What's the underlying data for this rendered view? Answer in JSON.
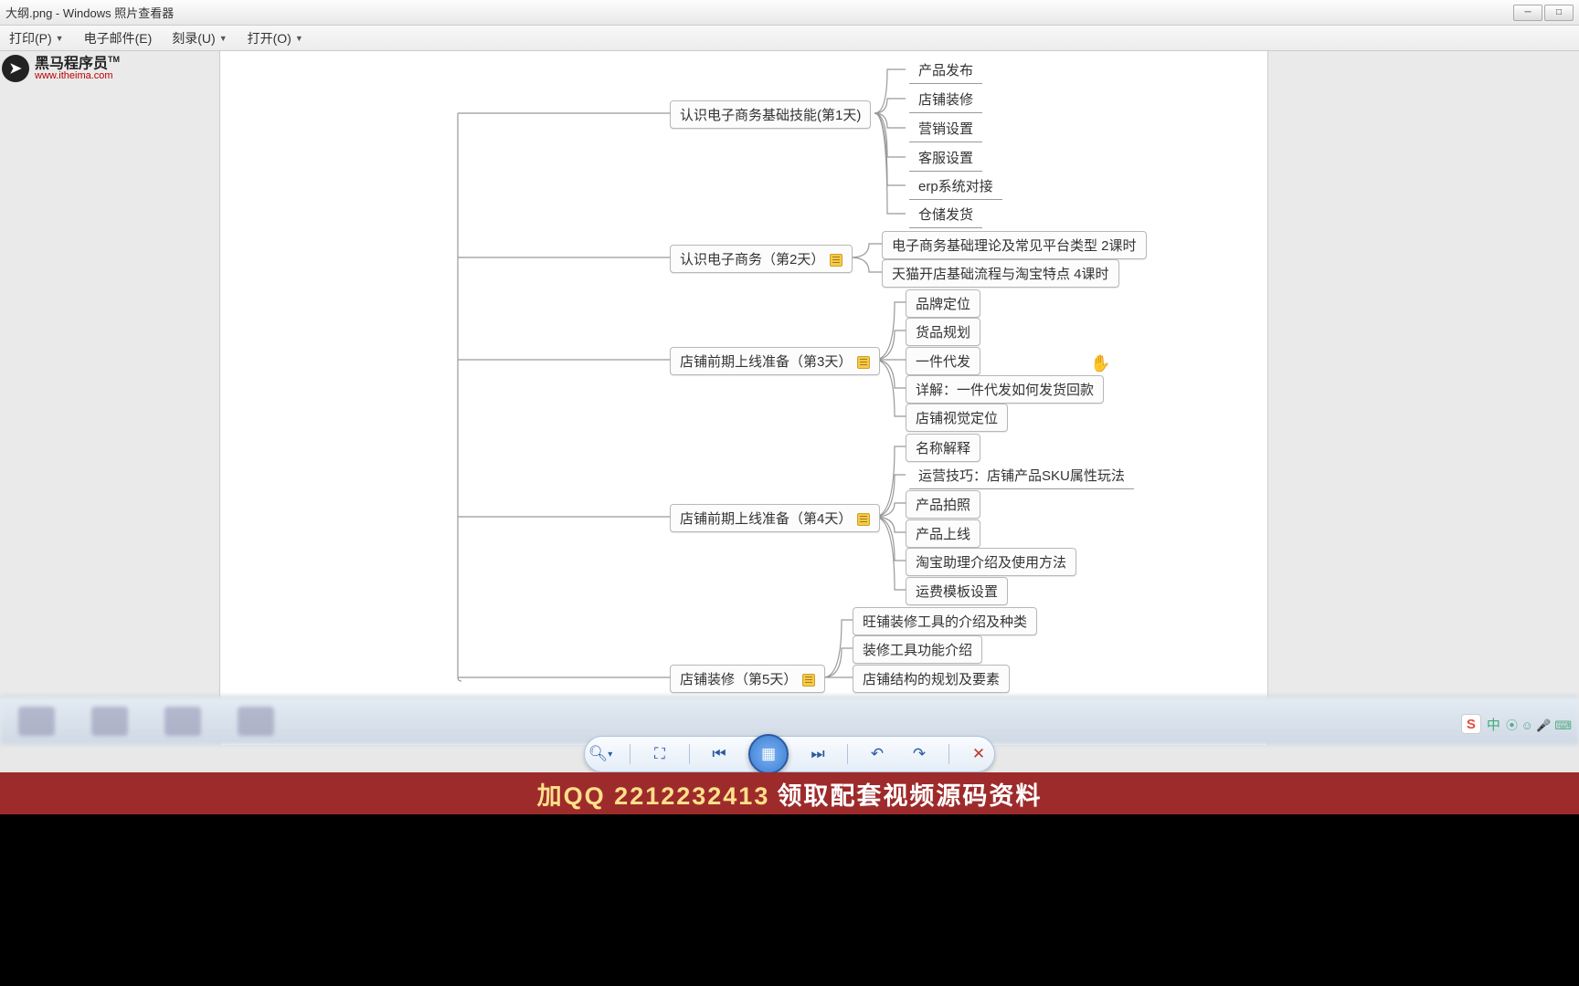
{
  "window": {
    "title_suffix": "大纲.png - Windows 照片查看器"
  },
  "menu": {
    "print": "打印(P)",
    "email": "电子邮件(E)",
    "burn": "刻录(U)",
    "open": "打开(O)"
  },
  "logo": {
    "cn": "黑马程序员",
    "en": "www.itheima.com",
    "tm": "TM"
  },
  "mindmap": {
    "n1": {
      "label": "认识电子商务基础技能(第1天)",
      "children": [
        "产品发布",
        "店铺装修",
        "营销设置",
        "客服设置",
        "erp系统对接",
        "仓储发货"
      ]
    },
    "n2": {
      "label": "认识电子商务（第2天）",
      "children": [
        "电子商务基础理论及常见平台类型  2课时",
        "天猫开店基础流程与淘宝特点 4课时"
      ]
    },
    "n3": {
      "label": "店铺前期上线准备（第3天）",
      "children": [
        "品牌定位",
        "货品规划",
        "一件代发",
        "详解：一件代发如何发货回款",
        "店铺视觉定位"
      ]
    },
    "n4": {
      "label": "店铺前期上线准备（第4天）",
      "children": [
        "名称解释",
        "运营技巧：店铺产品SKU属性玩法",
        "产品拍照",
        "产品上线",
        "淘宝助理介绍及使用方法",
        "运费模板设置"
      ]
    },
    "n5": {
      "label": "店铺装修（第5天）",
      "children": [
        "旺铺装修工具的介绍及种类",
        "装修工具功能介绍",
        "店铺结构的规划及要素"
      ]
    }
  },
  "ime": {
    "label": "中",
    "icons": "⦿ ☺ 🎤 ⌨"
  },
  "banner": {
    "prefix": "加QQ",
    "number": "2212232413",
    "suffix": "领取配套视频源码资料"
  }
}
